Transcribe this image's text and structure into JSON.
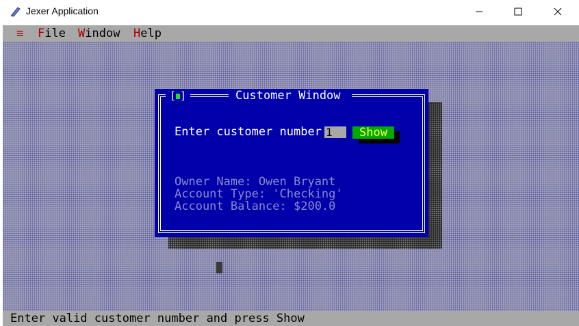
{
  "window": {
    "title": "Jexer Application"
  },
  "menubar": {
    "system_icon": "≡",
    "items": [
      {
        "hotkey": "F",
        "rest": "ile"
      },
      {
        "hotkey": "W",
        "rest": "indow"
      },
      {
        "hotkey": "H",
        "rest": "elp"
      }
    ]
  },
  "dialog": {
    "title": "Customer Window",
    "close_glyph_left": "[",
    "close_glyph_right": "]",
    "prompt": "Enter customer number:",
    "customer_number": "1",
    "show_label": "Show",
    "owner": "Owner Name: Owen Bryant",
    "account_type": "Account Type: 'Checking'",
    "balance": "Account Balance: $200.0"
  },
  "statusbar": {
    "text": "Enter valid customer number and press Show"
  },
  "colors": {
    "dialog_bg": "#0000aa",
    "button_bg": "#00aa00",
    "button_fg": "#ffff55",
    "menu_hotkey": "#aa0000",
    "bar_bg": "#a8a8a8"
  }
}
